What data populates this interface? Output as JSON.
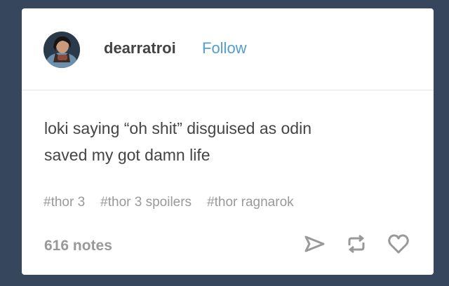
{
  "post": {
    "username": "dearratroi",
    "follow_label": "Follow",
    "avatar_icon": "user-avatar",
    "body": "loki saying “oh shit” disguised as odin\nsaved my got damn life",
    "tags": [
      "#thor 3",
      "#thor 3 spoilers",
      "#thor ragnarok"
    ],
    "notes": "616 notes",
    "actions": {
      "share_icon": "share-icon",
      "reblog_icon": "reblog-icon",
      "like_icon": "heart-icon"
    }
  },
  "colors": {
    "page_background": "#36465d",
    "card_background": "#ffffff",
    "text": "#444444",
    "link": "#529ecc",
    "muted": "#999999"
  }
}
